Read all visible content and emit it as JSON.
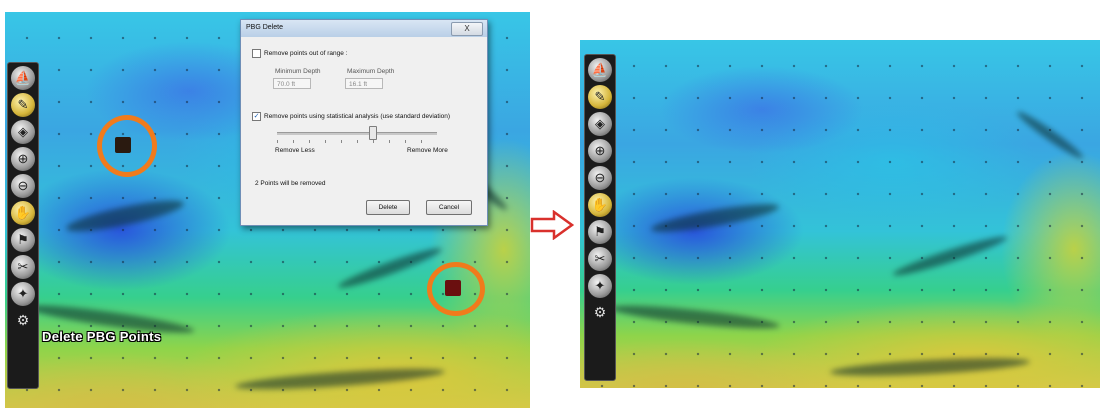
{
  "toolbar": {
    "tools": [
      {
        "icon": "sonar-boat-icon"
      },
      {
        "icon": "edit-icon"
      },
      {
        "icon": "fish-icon"
      },
      {
        "icon": "zoom-in-icon"
      },
      {
        "icon": "zoom-out-icon"
      },
      {
        "icon": "pan-hand-icon"
      },
      {
        "icon": "waypoint-pin-icon"
      },
      {
        "icon": "measure-icon"
      },
      {
        "icon": "delete-pbg-points-icon"
      }
    ],
    "bottom_icon": "settings-gears-icon",
    "active_tool_label": "Delete PBG Points"
  },
  "dialog": {
    "title": "PBG Delete",
    "close_label": "X",
    "range_option": {
      "label": "Remove points out of range :",
      "checked": false
    },
    "min_depth": {
      "label": "Minimum Depth",
      "value": "70.0 ft"
    },
    "max_depth": {
      "label": "Maximum Depth",
      "value": "16.1 ft"
    },
    "stat_option": {
      "label": "Remove points using statistical analysis (use standard deviation)",
      "checked": true
    },
    "slider": {
      "left_label": "Remove Less",
      "right_label": "Remove More",
      "value": 0.6
    },
    "status": "2 Points will be removed",
    "delete_button": "Delete",
    "cancel_button": "Cancel"
  },
  "colors": {
    "highlight_ring": "#f07b1c",
    "arrow": "#d9302c"
  }
}
